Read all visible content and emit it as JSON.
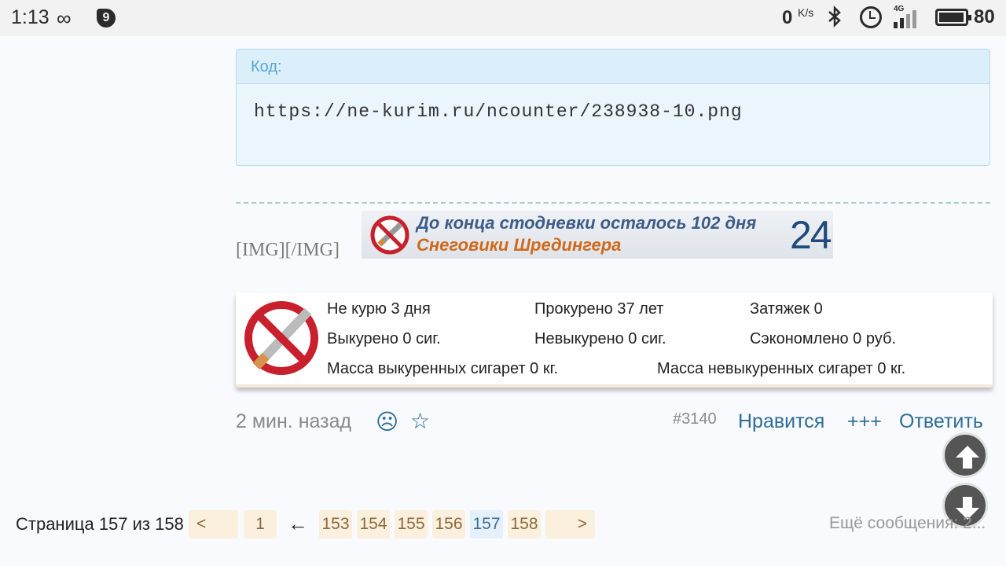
{
  "status_bar": {
    "time": "1:13",
    "infinity_icon": "∞",
    "maps_icon": "9",
    "net_speed": "0",
    "net_unit": "K/s",
    "network_label": "4G",
    "battery": "80"
  },
  "code_block": {
    "header": "Код:",
    "content": "https://ne-kurim.ru/ncounter/238938-10.png"
  },
  "post": {
    "img_tag": "[IMG][/IMG]",
    "banner": {
      "line1": "До конца стодневки осталось 102 дня",
      "line2": "Снеговики Шредингера",
      "number": "24"
    },
    "stats": {
      "not_smoking": "Не курю 3 дня",
      "smoked_years": "Прокурено 37 лет",
      "puffs": "Затяжек 0",
      "smoked_cigs": "Выкурено 0 сиг.",
      "not_smoked_cigs": "Невыкурено 0 сиг.",
      "saved": "Сэкономлено 0 руб.",
      "mass_smoked": "Масса выкуренных сигарет 0 кг.",
      "mass_not_smoked": "Масса невыкуренных сигарет 0 кг."
    },
    "footer": {
      "time": "2 мин. назад",
      "sad_icon": "☹",
      "star_icon": "☆",
      "post_number": "#3140",
      "like": "Нравится",
      "plus": "+++",
      "reply": "Ответить"
    }
  },
  "pagination": {
    "label": "Страница 157 из 158",
    "prev": "<",
    "first": "1",
    "arrow": "←",
    "pages": [
      "153",
      "154",
      "155",
      "156",
      "157",
      "158"
    ],
    "current_page": "157",
    "next": ">",
    "more": "Ещё сообщения: 2..."
  },
  "colors": {
    "link": "#2c6e96",
    "code_bg": "#eaf5fc",
    "page_btn_bg": "#fbefdd"
  }
}
